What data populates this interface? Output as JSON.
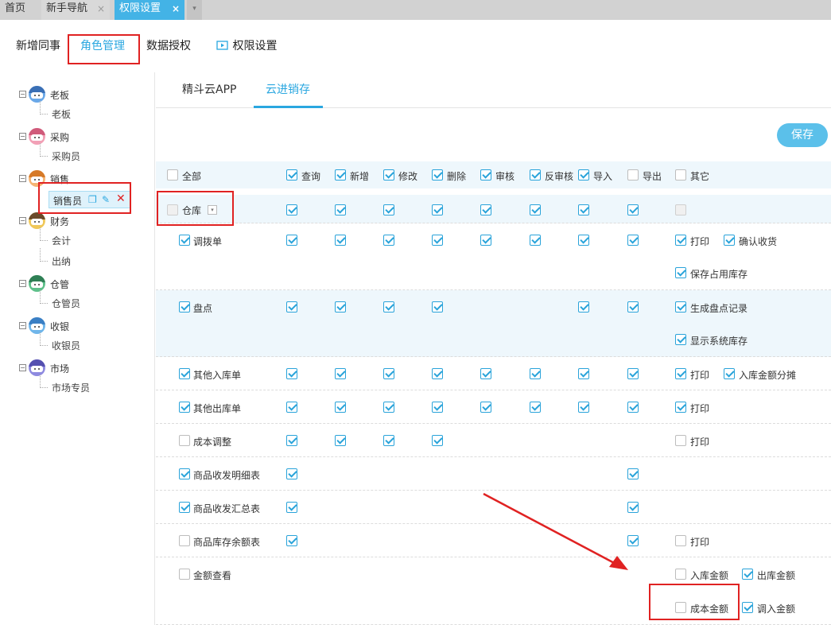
{
  "top_tabs": [
    {
      "label": "首页"
    },
    {
      "label": "新手导航",
      "close": "×"
    },
    {
      "label": "权限设置",
      "close": "×"
    }
  ],
  "top_more": "▾",
  "nav": [
    {
      "label": "新增同事"
    },
    {
      "label": "角色管理"
    },
    {
      "label": "数据授权"
    },
    {
      "label": "权限设置"
    }
  ],
  "tree": [
    {
      "label": "老板",
      "color": "#6aa8e8",
      "hair": "#3a6fb5",
      "children": [
        "老板"
      ]
    },
    {
      "label": "采购",
      "color": "#f2a0b6",
      "hair": "#d05a7a",
      "children": [
        "采购员"
      ]
    },
    {
      "label": "销售",
      "color": "#f5b473",
      "hair": "#d67a28",
      "children": [
        "销售员"
      ]
    },
    {
      "label": "财务",
      "color": "#f0c85a",
      "hair": "#6a4a2a",
      "children": [
        "会计",
        "出纳"
      ]
    },
    {
      "label": "仓管",
      "color": "#5ec08a",
      "hair": "#2f7f55",
      "children": [
        "仓管员"
      ]
    },
    {
      "label": "收银",
      "color": "#70b6ea",
      "hair": "#3a7fc4",
      "children": [
        "收银员"
      ]
    },
    {
      "label": "市场",
      "color": "#8e8ae0",
      "hair": "#5550b0",
      "children": [
        "市场专员"
      ]
    }
  ],
  "panel_tabs": [
    "精斗云APP",
    "云进销存"
  ],
  "save_label": "保存",
  "header": {
    "all": "全部",
    "cols": [
      "查询",
      "新增",
      "修改",
      "删除",
      "审核",
      "反审核",
      "导入",
      "导出",
      "其它"
    ],
    "checked": [
      true,
      true,
      true,
      true,
      true,
      true,
      true,
      false,
      false
    ]
  },
  "group": {
    "label": "仓库",
    "dropdown": "▾"
  },
  "rows": [
    {
      "label": "调拨单",
      "checked": true,
      "cols": [
        1,
        1,
        1,
        1,
        1,
        1,
        1,
        1
      ],
      "others": [
        {
          "label": "打印",
          "checked": true
        },
        {
          "label": "确认收货",
          "checked": true
        },
        {
          "label": "保存占用库存",
          "checked": true
        }
      ]
    },
    {
      "label": "盘点",
      "checked": true,
      "cols": [
        1,
        1,
        1,
        1,
        0,
        0,
        1,
        1
      ],
      "others": [
        {
          "label": "生成盘点记录",
          "checked": true
        },
        {
          "label": "显示系统库存",
          "checked": true
        }
      ]
    },
    {
      "label": "其他入库单",
      "checked": true,
      "cols": [
        1,
        1,
        1,
        1,
        1,
        1,
        1,
        1
      ],
      "others": [
        {
          "label": "打印",
          "checked": true
        },
        {
          "label": "入库金额分摊",
          "checked": true
        }
      ]
    },
    {
      "label": "其他出库单",
      "checked": true,
      "cols": [
        1,
        1,
        1,
        1,
        1,
        1,
        1,
        1
      ],
      "others": [
        {
          "label": "打印",
          "checked": true
        }
      ]
    },
    {
      "label": "成本调整",
      "checked": false,
      "cols": [
        1,
        1,
        1,
        1,
        0,
        0,
        0,
        0
      ],
      "others": [
        {
          "label": "打印",
          "checked": false
        }
      ]
    },
    {
      "label": "商品收发明细表",
      "checked": true,
      "cols": [
        1,
        0,
        0,
        0,
        0,
        0,
        0,
        1
      ],
      "others": []
    },
    {
      "label": "商品收发汇总表",
      "checked": true,
      "cols": [
        1,
        0,
        0,
        0,
        0,
        0,
        0,
        1
      ],
      "others": []
    },
    {
      "label": "商品库存余额表",
      "checked": false,
      "cols": [
        1,
        0,
        0,
        0,
        0,
        0,
        0,
        1
      ],
      "others": [
        {
          "label": "打印",
          "checked": false
        }
      ]
    },
    {
      "label": "金额查看",
      "checked": false,
      "cols": [
        0,
        0,
        0,
        0,
        0,
        0,
        0,
        0
      ],
      "others": [
        {
          "label": "入库金额",
          "checked": false
        },
        {
          "label": "出库金额",
          "checked": true
        },
        {
          "label": "成本金额",
          "checked": false
        },
        {
          "label": "调入金额",
          "checked": true
        }
      ]
    }
  ]
}
